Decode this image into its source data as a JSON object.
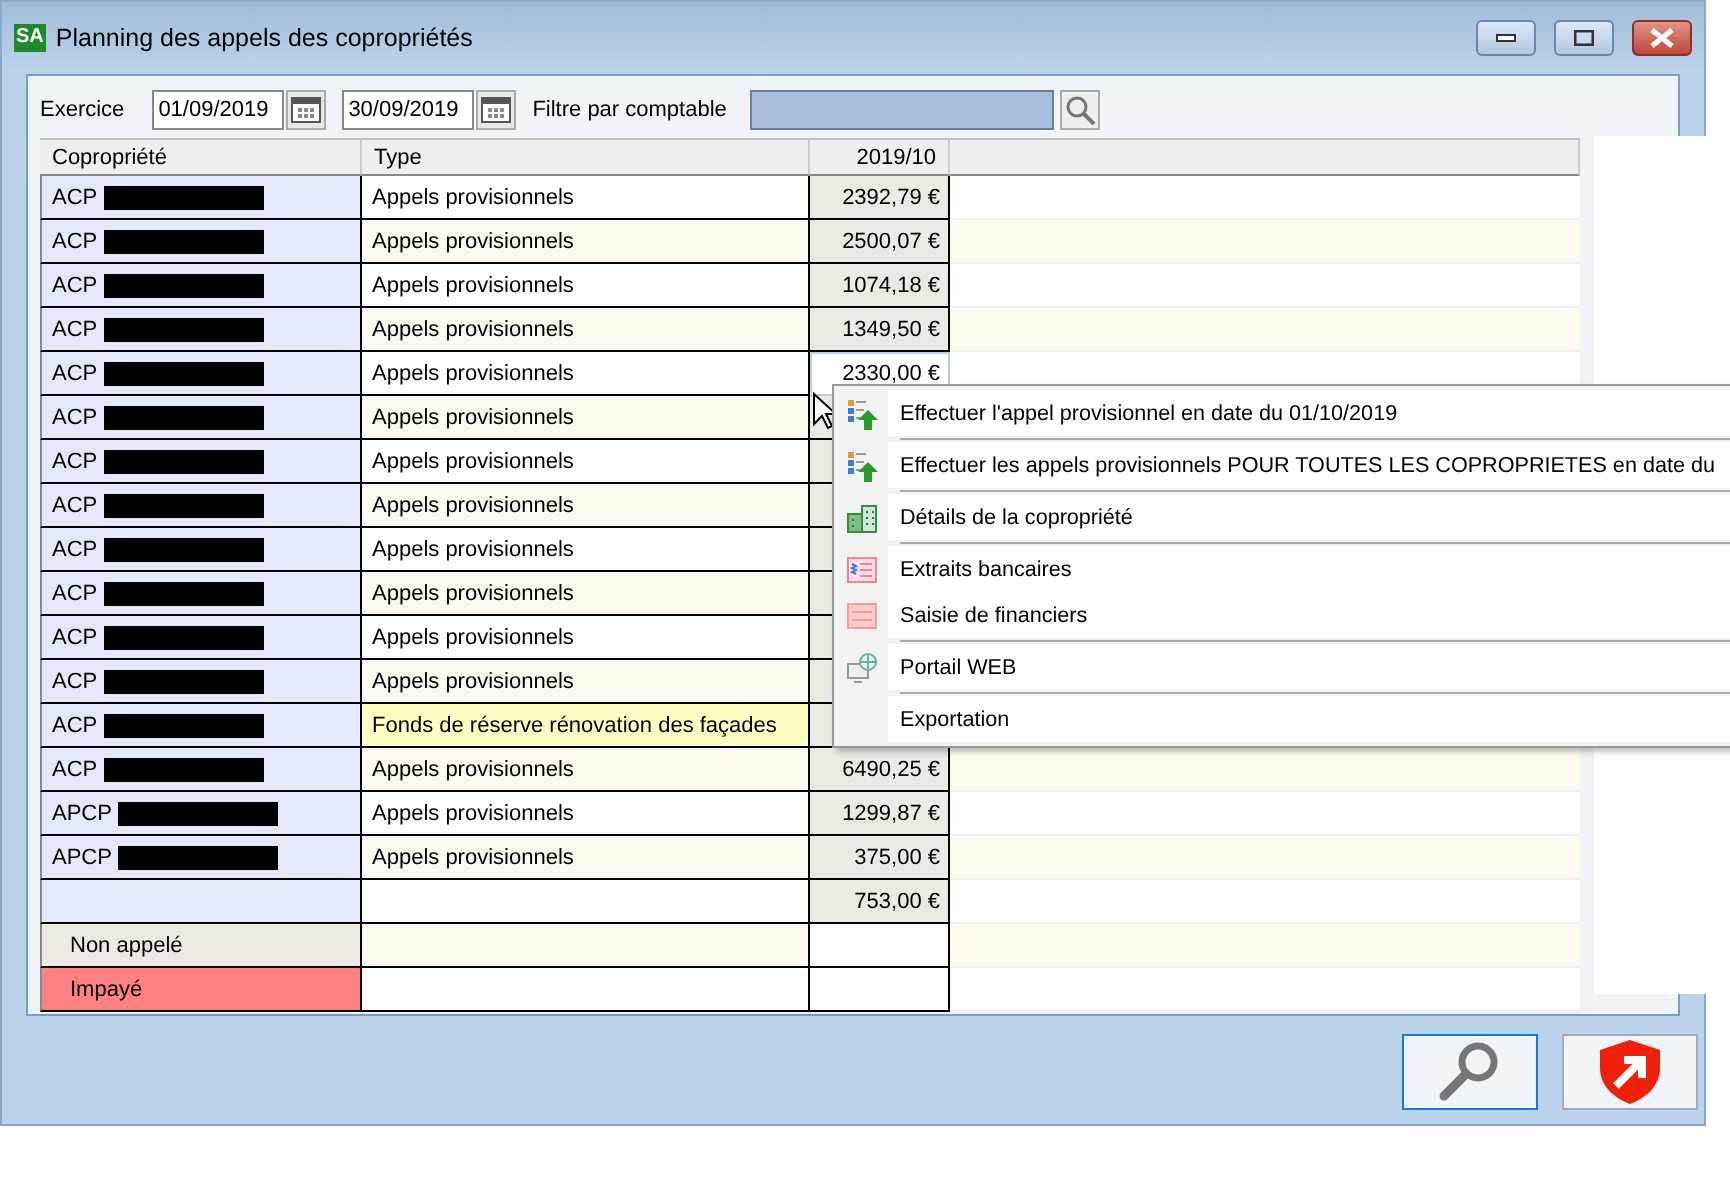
{
  "window": {
    "app_icon": "SA",
    "title": "Planning des appels des copropriétés"
  },
  "filters": {
    "exercise_label": "Exercice",
    "date_from": "01/09/2019",
    "date_to": "30/09/2019",
    "accountant_label": "Filtre par comptable"
  },
  "table": {
    "columns": [
      "Copropriété",
      "Type",
      "2019/10"
    ],
    "rows": [
      {
        "name": "ACP",
        "redacted": true,
        "type": "Appels provisionnels",
        "amount": "2392,79 €",
        "highlighted": false,
        "selected": false
      },
      {
        "name": "ACP",
        "redacted": true,
        "type": "Appels provisionnels",
        "amount": "2500,07 €",
        "highlighted": false,
        "selected": false
      },
      {
        "name": "ACP",
        "redacted": true,
        "type": "Appels provisionnels",
        "amount": "1074,18 €",
        "highlighted": false,
        "selected": false
      },
      {
        "name": "ACP",
        "redacted": true,
        "type": "Appels provisionnels",
        "amount": "1349,50 €",
        "highlighted": false,
        "selected": false
      },
      {
        "name": "ACP",
        "redacted": true,
        "type": "Appels provisionnels",
        "amount": "2330,00 €",
        "highlighted": false,
        "selected": true
      },
      {
        "name": "ACP",
        "redacted": true,
        "type": "Appels provisionnels",
        "highlighted": false,
        "selected": false
      },
      {
        "name": "ACP",
        "redacted": true,
        "type": "Appels provisionnels",
        "highlighted": false,
        "selected": false
      },
      {
        "name": "ACP",
        "redacted": true,
        "type": "Appels provisionnels",
        "highlighted": false,
        "selected": false
      },
      {
        "name": "ACP",
        "redacted": true,
        "type": "Appels provisionnels",
        "highlighted": false,
        "selected": false
      },
      {
        "name": "ACP",
        "redacted": true,
        "type": "Appels provisionnels",
        "highlighted": false,
        "selected": false
      },
      {
        "name": "ACP",
        "redacted": true,
        "type": "Appels provisionnels",
        "highlighted": false,
        "selected": false
      },
      {
        "name": "ACP",
        "redacted": true,
        "type": "Appels provisionnels",
        "highlighted": false,
        "selected": false
      },
      {
        "name": "ACP",
        "redacted": true,
        "type": "Fonds de réserve rénovation des façades",
        "highlighted": true,
        "selected": false
      },
      {
        "name": "ACP",
        "redacted": true,
        "type": "Appels provisionnels",
        "amount": "6490,25 €",
        "highlighted": false,
        "selected": false
      },
      {
        "name": "APCP",
        "redacted": true,
        "type": "Appels provisionnels",
        "amount": "1299,87 €",
        "highlighted": false,
        "selected": false
      },
      {
        "name": "APCP",
        "redacted": true,
        "type": "Appels provisionnels",
        "amount": "375,00 €",
        "highlighted": false,
        "selected": false
      },
      {
        "redacted": false,
        "amount": "753,00 €",
        "highlighted": false,
        "selected": false
      }
    ]
  },
  "summary_rows": [
    {
      "label": "Non appelé",
      "color": "#ece9e3"
    },
    {
      "label": "Impayé",
      "color": "#ff8080"
    }
  ],
  "context_menu": {
    "items": [
      {
        "kind": "upload",
        "label": "Effectuer l'appel provisionnel en date du 01/10/2019",
        "separator_after": true
      },
      {
        "kind": "upload",
        "label": "Effectuer les appels provisionnels POUR TOUTES LES COPROPRIETES en date du",
        "separator_after": true
      },
      {
        "kind": "building",
        "label": "Détails de la copropriété",
        "separator_after": true
      },
      {
        "kind": "bank",
        "label": "Extraits bancaires",
        "separator_after": false
      },
      {
        "kind": "form",
        "label": "Saisie de financiers",
        "separator_after": true
      },
      {
        "kind": "web",
        "label": "Portail WEB",
        "separator_after": true
      },
      {
        "kind": "none",
        "label": "Exportation",
        "separator_after": false
      }
    ]
  }
}
